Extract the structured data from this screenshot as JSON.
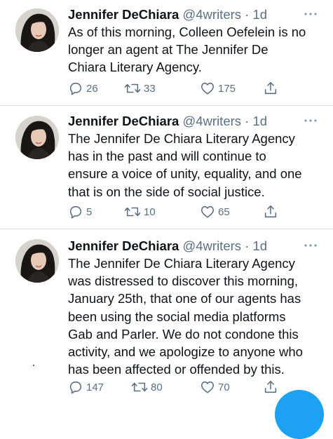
{
  "tweets": [
    {
      "name": "Jennifer DeChiara",
      "handle": "@4writers",
      "sep": " · ",
      "time": "1d",
      "lines": [
        "As of this morning, Colleen Oefelein is no",
        "longer an agent at The Jennifer De",
        "Chiara Literary Agency."
      ],
      "replies": "26",
      "retweets": "33",
      "likes": "175"
    },
    {
      "name": "Jennifer DeChiara",
      "handle": "@4writers",
      "sep": " · ",
      "time": "1d",
      "lines": [
        "The Jennifer De Chiara Literary Agency",
        "has in the past and will continue to",
        "ensure a voice of unity, equality, and one",
        "that is on the side of social justice."
      ],
      "replies": "5",
      "retweets": "10",
      "likes": "65"
    },
    {
      "name": "Jennifer DeChiara",
      "handle": "@4writers",
      "sep": " · ",
      "time": "1d",
      "lines": [
        "The Jennifer De Chiara Literary Agency",
        "was distressed to discover this morning,",
        "January 25th, that one of our agents has",
        "been using the social media platforms",
        "Gab and Parler. We do not condone this",
        "activity, and we apologize to anyone who",
        "has been affected or offended by this."
      ],
      "replies": "147",
      "retweets": "80",
      "likes": "70"
    }
  ],
  "icons": {
    "reply": "reply-icon",
    "retweet": "retweet-icon",
    "like": "like-icon",
    "share": "share-icon",
    "more": "more-icon"
  },
  "colors": {
    "text": "#0f1419",
    "muted": "#5b7083",
    "divider": "#e1e6ea",
    "accent": "#1da1f2"
  }
}
